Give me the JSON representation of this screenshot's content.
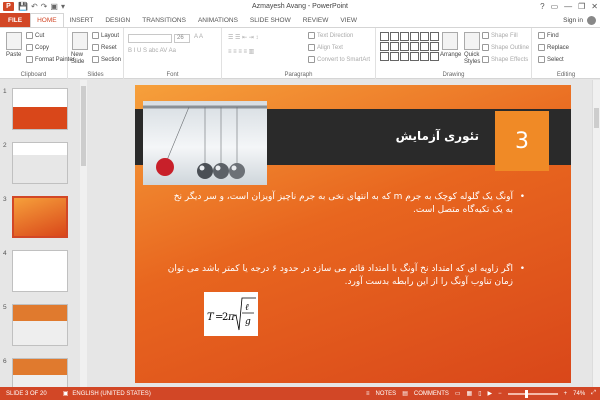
{
  "window": {
    "title": "Azmayesh Avang - PowerPoint",
    "controls": [
      "?",
      "▭",
      "—",
      "❐",
      "✕"
    ]
  },
  "app_icon": "P",
  "qat": [
    "💾",
    "↶",
    "↷",
    "▣",
    "▾"
  ],
  "tabs": [
    "FILE",
    "HOME",
    "INSERT",
    "DESIGN",
    "TRANSITIONS",
    "ANIMATIONS",
    "SLIDE SHOW",
    "REVIEW",
    "VIEW"
  ],
  "active_tab": "HOME",
  "signin": "Sign in",
  "ribbon": {
    "clipboard": {
      "paste": "Paste",
      "cut": "Cut",
      "copy": "Copy",
      "format_painter": "Format Painter",
      "label": "Clipboard"
    },
    "slides": {
      "new_slide": "New",
      "new_slide_2": "Slide",
      "layout": "Layout",
      "reset": "Reset",
      "section": "Section",
      "label": "Slides"
    },
    "font": {
      "size": "26",
      "label": "Font"
    },
    "paragraph": {
      "text_direction": "Text Direction",
      "align_text": "Align Text",
      "convert": "Convert to SmartArt",
      "label": "Paragraph"
    },
    "drawing": {
      "arrange": "Arrange",
      "quick_styles": "Quick",
      "quick_styles_2": "Styles",
      "shape_fill": "Shape Fill",
      "shape_outline": "Shape Outline",
      "shape_effects": "Shape Effects",
      "label": "Drawing"
    },
    "editing": {
      "find": "Find",
      "replace": "Replace",
      "select": "Select",
      "label": "Editing"
    }
  },
  "thumbnails": [
    {
      "num": "1"
    },
    {
      "num": "2"
    },
    {
      "num": "3"
    },
    {
      "num": "4"
    },
    {
      "num": "5"
    },
    {
      "num": "6"
    }
  ],
  "slide": {
    "number": "3",
    "title": "تئوری آزمایش",
    "bullets": [
      "آونگ  یک گلوله کوچک به جرم m که به انتهای نخی به جرم ناچیز آویزان است، و سر دیگر نخ به یک تکیه‌گاه متصل است.",
      "اگر زاویه ای که امتداد نخ آونگ با امتداد قائم می سازد در حدود ۶ درجه یا کمتر باشد می توان زمان تناوب آونگ را از این رابطه بدست آورد."
    ],
    "formula": "T = 2π√(ℓ/g)"
  },
  "status": {
    "slide_info": "SLIDE 3 OF 20",
    "language": "ENGLISH (UNITED STATES)",
    "notes": "NOTES",
    "comments": "COMMENTS",
    "zoom": "74%",
    "zoom_level": 0.74
  },
  "colors": {
    "accent": "#d24726",
    "slide_orange": "#e8661f",
    "band": "#2a2a2a",
    "number_box": "#f08a26"
  },
  "icons": [
    "paste-icon",
    "cut-icon",
    "copy-icon",
    "format-painter-icon",
    "new-slide-icon",
    "find-icon",
    "replace-icon",
    "select-icon",
    "notes-icon",
    "comments-icon"
  ]
}
